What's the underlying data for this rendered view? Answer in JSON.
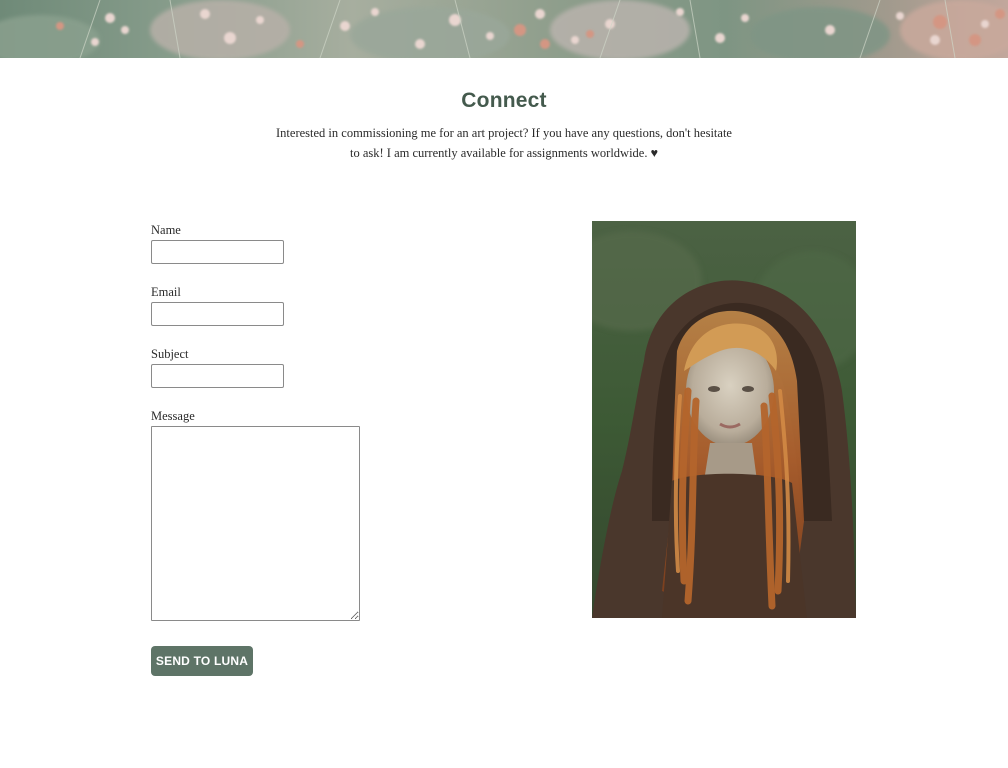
{
  "connect": {
    "title": "Connect",
    "intro_line1": "Interested in commissioning me for an art project? If you have any questions, don't hesitate",
    "intro_line2": "to ask! I am currently available for assignments worldwide. ♥"
  },
  "form": {
    "name_label": "Name",
    "name_value": "",
    "email_label": "Email",
    "email_value": "",
    "subject_label": "Subject",
    "subject_value": "",
    "message_label": "Message",
    "message_value": "",
    "submit_label": "SEND TO LUNA"
  },
  "images": {
    "banner": "wildflower-field-banner",
    "portrait": "hooded-woman-portrait"
  },
  "colors": {
    "heading": "#445a4d",
    "button": "#5e7467",
    "button_text": "#ffffff",
    "background": "#ffffff"
  }
}
